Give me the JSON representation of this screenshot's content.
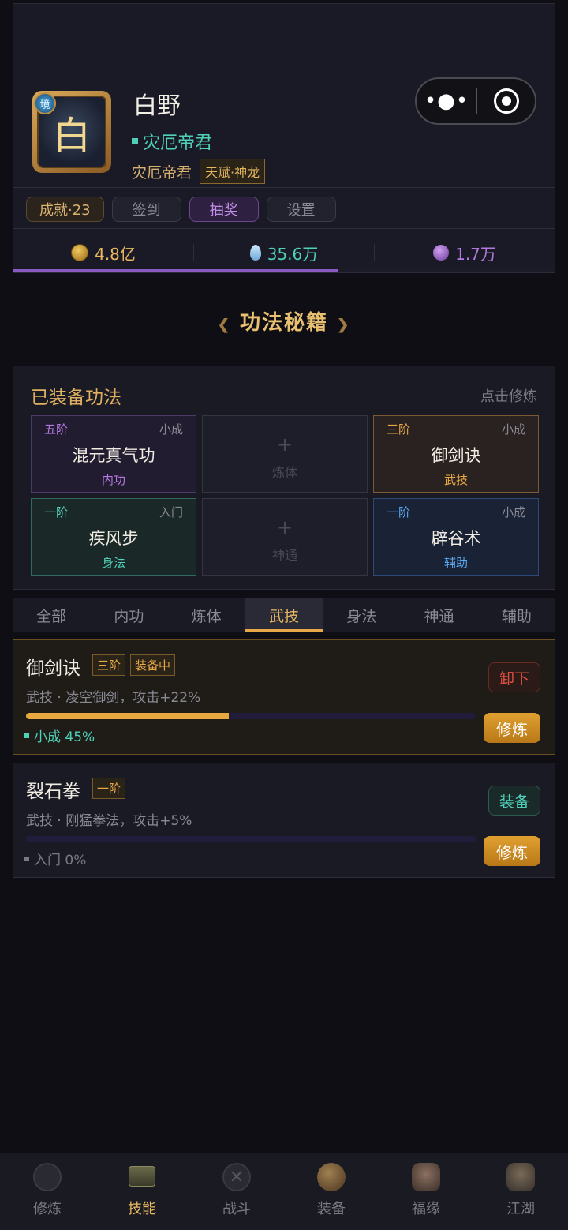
{
  "profile": {
    "avatar_char": "白",
    "avatar_badge": "境",
    "name": "白野",
    "title": "灾厄帝君",
    "sub_title": "灾厄帝君",
    "talent": "天赋·神龙"
  },
  "capsule": {
    "more_icon": "more-dots-icon",
    "close_icon": "target-icon"
  },
  "chips": [
    {
      "label": "成就·23"
    },
    {
      "label": "签到"
    },
    {
      "label": "抽奖"
    },
    {
      "label": "设置"
    }
  ],
  "currency": {
    "gold": {
      "icon": "gold-coin-icon",
      "value": "4.8亿",
      "color": "#e8b860"
    },
    "jade": {
      "icon": "jade-drop-icon",
      "value": "35.6万",
      "color": "#4fd0b8"
    },
    "spirit": {
      "icon": "spirit-orb-icon",
      "value": "1.7万",
      "color": "#b478e0"
    }
  },
  "progress_fraction": 0.6,
  "section_title": "功法秘籍",
  "equipped": {
    "title": "已装备功法",
    "hint": "点击修炼",
    "slots": [
      {
        "tier": "五阶",
        "stage": "小成",
        "name": "混元真气功",
        "type": "内功"
      },
      {
        "empty_label": "炼体",
        "plus": "+"
      },
      {
        "tier": "三阶",
        "stage": "小成",
        "name": "御剑诀",
        "type": "武技"
      },
      {
        "tier": "一阶",
        "stage": "入门",
        "name": "疾风步",
        "type": "身法"
      },
      {
        "empty_label": "神通",
        "plus": "+"
      },
      {
        "tier": "一阶",
        "stage": "小成",
        "name": "辟谷术",
        "type": "辅助"
      }
    ]
  },
  "tabs": [
    "全部",
    "内功",
    "炼体",
    "武技",
    "身法",
    "神通",
    "辅助"
  ],
  "active_tab": "武技",
  "skills": [
    {
      "name": "御剑诀",
      "tier_tag": "三阶",
      "status_tag": "装备中",
      "desc": "武技 · 凌空御剑，攻击+22%",
      "progress": 0.45,
      "level_text": "小成 45%",
      "action": "卸下",
      "train": "修炼"
    },
    {
      "name": "裂石拳",
      "tier_tag": "一阶",
      "desc": "武技 · 刚猛拳法，攻击+5%",
      "progress": 0,
      "level_text": "入门 0%",
      "action": "装备",
      "train": "修炼"
    }
  ],
  "nav": [
    {
      "label": "修炼",
      "icon": "meditation-icon"
    },
    {
      "label": "技能",
      "icon": "skill-scroll-icon"
    },
    {
      "label": "战斗",
      "icon": "crossed-swords-icon"
    },
    {
      "label": "装备",
      "icon": "equipment-icon"
    },
    {
      "label": "福缘",
      "icon": "fortune-icon"
    },
    {
      "label": "江湖",
      "icon": "jianghu-icon"
    }
  ],
  "active_nav": "技能"
}
